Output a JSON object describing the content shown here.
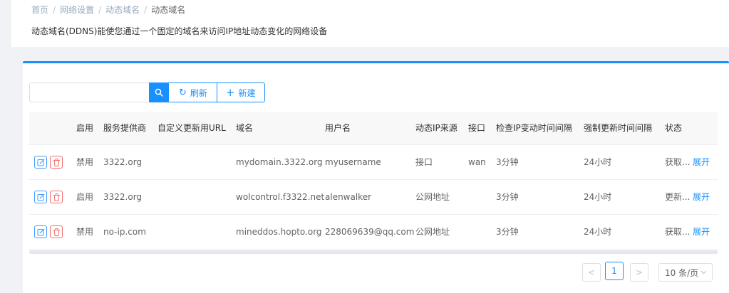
{
  "breadcrumb": {
    "items": [
      "首页",
      "网络设置",
      "动态域名",
      "动态域名"
    ]
  },
  "description": "动态域名(DDNS)能使您通过一个固定的域名来访问IP地址动态变化的网络设备",
  "toolbar": {
    "search_value": "",
    "refresh_label": "刷新",
    "add_label": "新建"
  },
  "table": {
    "columns": [
      "启用",
      "服务提供商",
      "自定义更新用URL",
      "域名",
      "用户名",
      "动态IP来源",
      "接口",
      "检查IP变动时间间隔",
      "强制更新时间间隔",
      "状态"
    ],
    "rows": [
      {
        "enabled": "禁用",
        "provider": "3322.org",
        "url": "",
        "domain": "mydomain.3322.org",
        "username": "myusername",
        "ip_source": "接口",
        "iface": "wan",
        "check_interval": "3分钟",
        "force_interval": "24小时",
        "status": "获取...",
        "expand": "展开"
      },
      {
        "enabled": "启用",
        "provider": "3322.org",
        "url": "",
        "domain": "wolcontrol.f3322.net",
        "username": "alenwalker",
        "ip_source": "公网地址",
        "iface": "",
        "check_interval": "3分钟",
        "force_interval": "24小时",
        "status": "更新...",
        "expand": "展开"
      },
      {
        "enabled": "禁用",
        "provider": "no-ip.com",
        "url": "",
        "domain": "mineddos.hopto.org",
        "username": "228069639@qq.com",
        "ip_source": "公网地址",
        "iface": "",
        "check_interval": "3分钟",
        "force_interval": "24小时",
        "status": "获取...",
        "expand": "展开"
      }
    ]
  },
  "pagination": {
    "prev": "<",
    "current_page": "1",
    "next": ">",
    "page_size": "10 条/页"
  },
  "colors": {
    "accent": "#1890ff",
    "danger": "#f56c6c"
  }
}
